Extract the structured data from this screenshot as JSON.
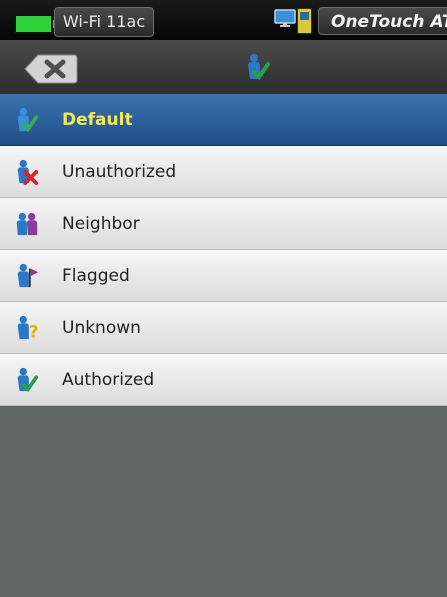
{
  "status": {
    "network_label": "Wi-Fi 11ac",
    "product_label": "OneTouch AT",
    "battery_icon": "battery-icon",
    "monitor_icon": "monitor-icon",
    "device_icon": "device-icon"
  },
  "header": {
    "back_icon": "back-x-icon",
    "category_icon": "person-check-icon"
  },
  "list": {
    "items": [
      {
        "label": "Default",
        "icon": "person-check-icon",
        "selected": true
      },
      {
        "label": "Unauthorized",
        "icon": "person-x-icon",
        "selected": false
      },
      {
        "label": "Neighbor",
        "icon": "two-people-icon",
        "selected": false
      },
      {
        "label": "Flagged",
        "icon": "person-flag-icon",
        "selected": false
      },
      {
        "label": "Unknown",
        "icon": "person-question-icon",
        "selected": false
      },
      {
        "label": "Authorized",
        "icon": "person-check-icon",
        "selected": false
      }
    ]
  },
  "colors": {
    "selected_bg": "#2c5f9c",
    "selected_text": "#f5ea55",
    "empty_bg": "#5f655f"
  }
}
